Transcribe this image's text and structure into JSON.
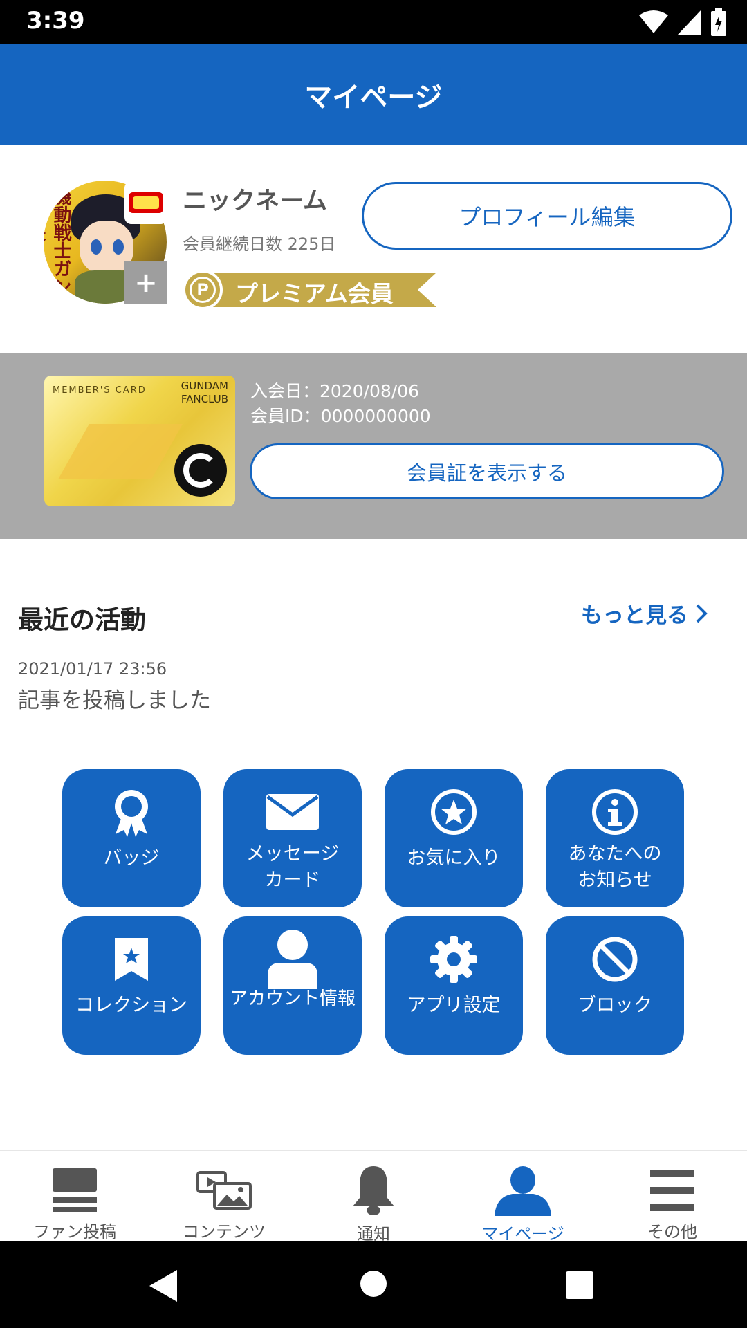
{
  "status_bar": {
    "time": "3:39"
  },
  "header": {
    "title": "マイページ"
  },
  "profile": {
    "nickname": "ニックネーム",
    "days": "会員継続日数 225日",
    "premium_label": "プレミアム会員",
    "premium_coin": "P",
    "edit_button": "プロフィール編集",
    "avatar_plus": "+",
    "avatar_text": "機動戦士ガンダム鉄血のオルフェンズ"
  },
  "member_card": {
    "card_title": "MEMBER'S CARD",
    "card_brand_1": "GUNDAM",
    "card_brand_2": "FANCLUB",
    "join_date": "入会日：2020/08/06",
    "member_id": "会員ID：0000000000",
    "show_button": "会員証を表示する"
  },
  "recent": {
    "title": "最近の活動",
    "more": "もっと見る",
    "items": [
      {
        "time": "2021/01/17 23:56",
        "text": "記事を投稿しました"
      }
    ]
  },
  "grid": [
    {
      "label": "バッジ",
      "icon": "badge-icon"
    },
    {
      "label_1": "メッセージ",
      "label_2": "カード",
      "icon": "envelope-icon"
    },
    {
      "label": "お気に入り",
      "icon": "star-circle-icon"
    },
    {
      "label_1": "あなたへの",
      "label_2": "お知らせ",
      "icon": "info-icon"
    },
    {
      "label": "コレクション",
      "icon": "bookmark-star-icon"
    },
    {
      "label": "アカウント情報",
      "icon": "person-icon"
    },
    {
      "label": "アプリ設定",
      "icon": "gear-icon"
    },
    {
      "label": "ブロック",
      "icon": "block-icon"
    }
  ],
  "bottom_nav": [
    {
      "label": "ファン投稿",
      "icon": "posts-icon"
    },
    {
      "label": "コンテンツ",
      "icon": "contents-icon"
    },
    {
      "label": "通知",
      "icon": "bell-icon"
    },
    {
      "label": "マイページ",
      "icon": "person-icon",
      "active": true
    },
    {
      "label": "その他",
      "icon": "menu-icon"
    }
  ],
  "colors": {
    "primary": "#1565c0",
    "gold": "#c4a949",
    "band": "#a9a9a9"
  }
}
